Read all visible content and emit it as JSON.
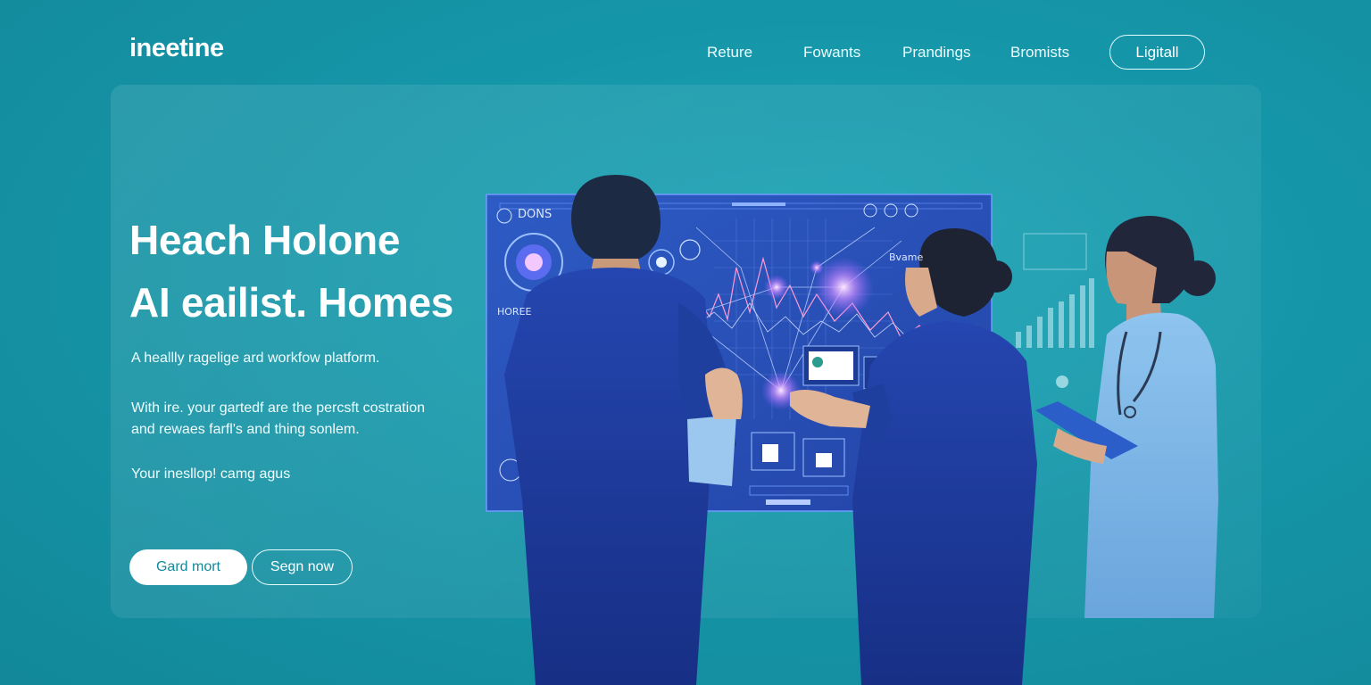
{
  "brand": {
    "logo": "ineetine"
  },
  "nav": {
    "links": [
      "Reture",
      "Fowants",
      "Prandings",
      "Bromists"
    ],
    "cta": "Ligitall"
  },
  "hero": {
    "headline_line1": "Heach Holone",
    "headline_line2": "AI eailist. Homes",
    "tagline": "A heallly ragelige ard workfow platform.",
    "body_line1": "With ire. your gartedf are the percsft costration",
    "body_line2": "and rewaes farfl's and thing sonlem.",
    "note": "Your inesllop! camg agus",
    "primary_button": "Gard mort",
    "secondary_button": "Segn now"
  },
  "illustration": {
    "screen_label": "DONS",
    "screen_side_label": "HOREE",
    "screen_right_label": "Bvame"
  },
  "colors": {
    "background": "#1596a8",
    "screen": "#2a4fb8",
    "coat_dark": "#1e3a9a",
    "coat_light": "#7fb6e6",
    "accent_glow": "#d9a6ff"
  }
}
